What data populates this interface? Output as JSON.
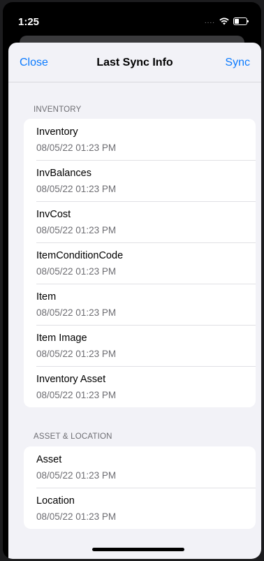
{
  "status_bar": {
    "time": "1:25",
    "signal": "...."
  },
  "nav": {
    "close_label": "Close",
    "title": "Last Sync Info",
    "sync_label": "Sync"
  },
  "sections": [
    {
      "header": "INVENTORY",
      "items": [
        {
          "title": "Inventory",
          "timestamp": "08/05/22 01:23 PM"
        },
        {
          "title": "InvBalances",
          "timestamp": "08/05/22 01:23 PM"
        },
        {
          "title": "InvCost",
          "timestamp": "08/05/22 01:23 PM"
        },
        {
          "title": "ItemConditionCode",
          "timestamp": "08/05/22 01:23 PM"
        },
        {
          "title": "Item",
          "timestamp": "08/05/22 01:23 PM"
        },
        {
          "title": "Item Image",
          "timestamp": "08/05/22 01:23 PM"
        },
        {
          "title": "Inventory Asset",
          "timestamp": "08/05/22 01:23 PM"
        }
      ]
    },
    {
      "header": "ASSET & LOCATION",
      "items": [
        {
          "title": "Asset",
          "timestamp": "08/05/22 01:23 PM"
        },
        {
          "title": "Location",
          "timestamp": "08/05/22 01:23 PM"
        }
      ]
    }
  ],
  "colors": {
    "accent": "#0a7aff",
    "background": "#f2f2f7",
    "secondary_text": "#6d6d72"
  }
}
